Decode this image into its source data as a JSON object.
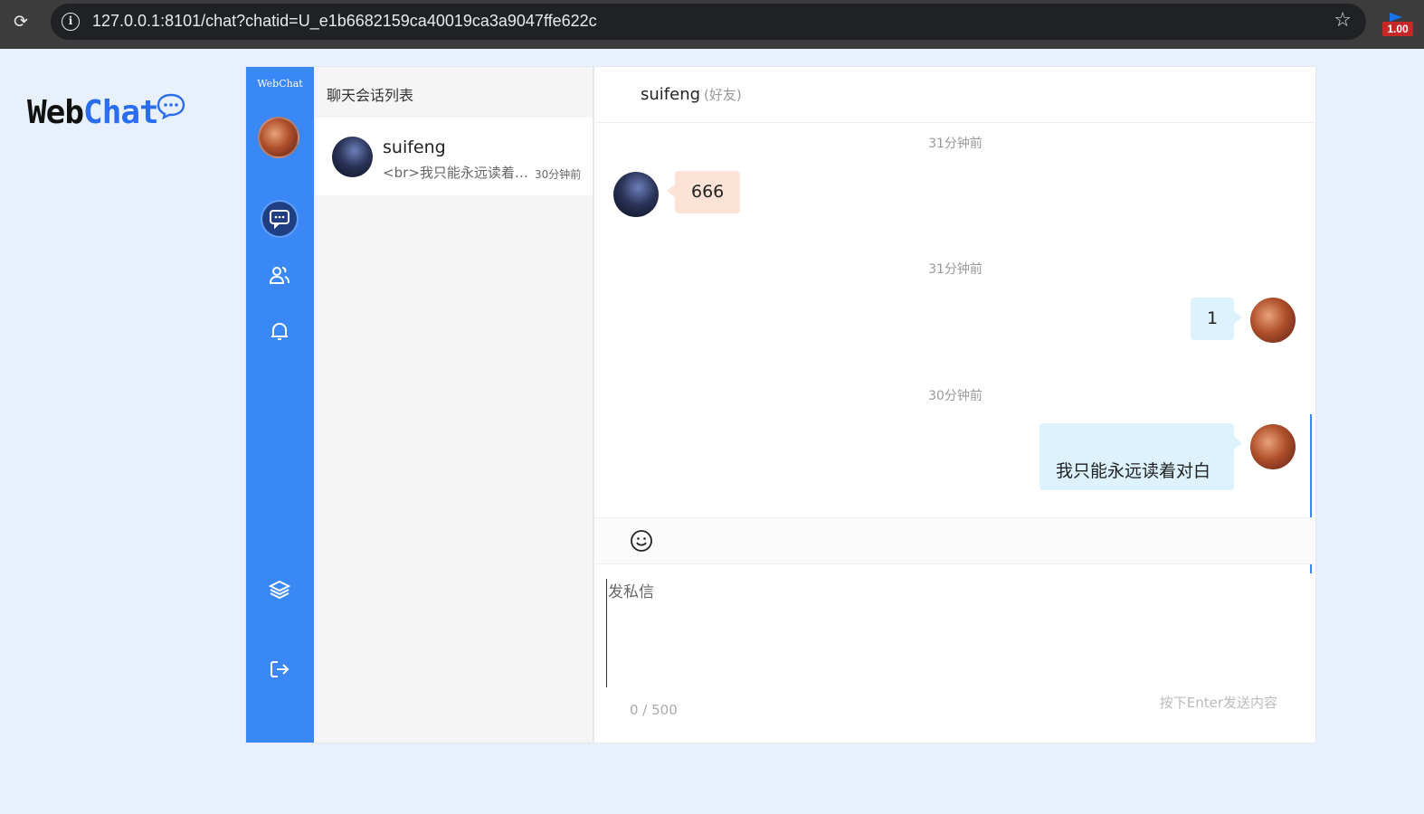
{
  "browser": {
    "url": "127.0.0.1:8101/chat?chatid=U_e1b6682159ca40019ca3a9047ffe622c",
    "reload_icon": "reload-icon",
    "info_icon": "info-icon",
    "star_icon": "star-icon",
    "extension_badge": "1.00"
  },
  "brand": {
    "web": "Web",
    "chat": "Chat",
    "bubble_icon": "chat-bubble-icon",
    "accent": "#2b6df0"
  },
  "rail": {
    "title": "WebChat",
    "bg": "#3a88f5",
    "items": [
      {
        "icon": "chat-icon",
        "active": true
      },
      {
        "icon": "contacts-icon",
        "active": false
      },
      {
        "icon": "bell-icon",
        "active": false
      },
      {
        "icon": "layers-icon",
        "active": false
      },
      {
        "icon": "logout-icon",
        "active": false
      }
    ]
  },
  "conversation_list": {
    "title": "聊天会话列表",
    "items": [
      {
        "name": "suifeng",
        "last_message": "<br>我只能永远读着对白",
        "time": "30分钟前"
      }
    ]
  },
  "chat": {
    "name": "suifeng",
    "tag": "(好友)",
    "messages": [
      {
        "time": "31分钟前",
        "side": "left",
        "text": "666"
      },
      {
        "time": "31分钟前",
        "side": "right",
        "text": "1"
      },
      {
        "time": "30分钟前",
        "side": "right",
        "text": "我只能永远读着对白"
      }
    ],
    "emoji_icon": "smile-icon",
    "input_placeholder": "发私信",
    "counter": "0 / 500",
    "hint": "按下Enter发送内容",
    "colors": {
      "bubble_left": "#fde3d6",
      "bubble_right": "#dcf2fd"
    }
  }
}
